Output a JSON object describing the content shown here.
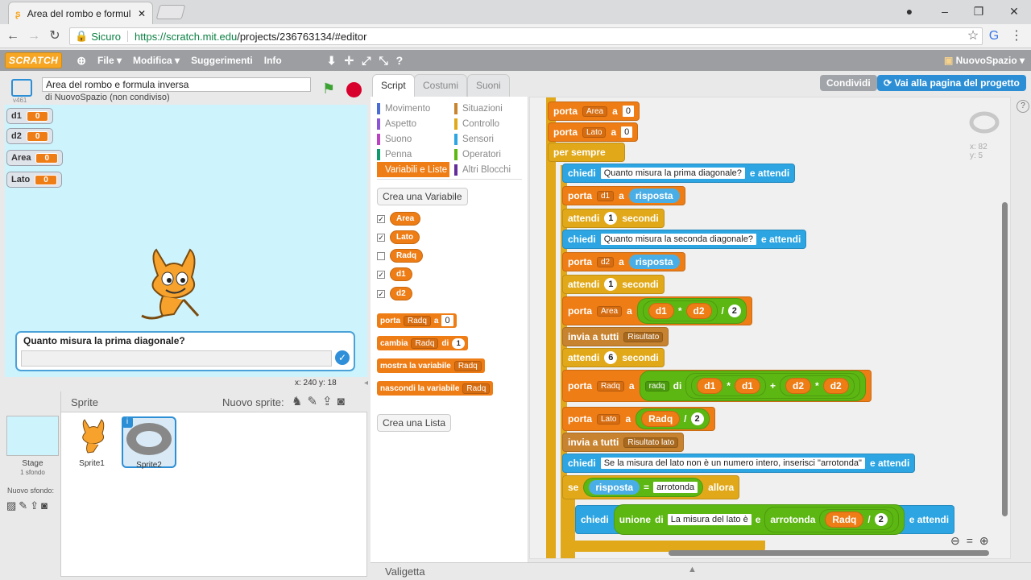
{
  "browser": {
    "tab_title": "Area del rombo e formul…",
    "secure_label": "Sicuro",
    "url_prefix": "https://scratch.mit.edu",
    "url_path": "/projects/236763134/#editor"
  },
  "menubar": {
    "logo": "SCRATCH",
    "items": [
      "File ▾",
      "Modifica ▾",
      "Suggerimenti",
      "Info"
    ],
    "user": "NuovoSpazio ▾"
  },
  "project": {
    "title": "Area del rombo e formula inversa",
    "byline": "di NuovoSpazio (non condiviso)",
    "version": "v461"
  },
  "monitors": [
    {
      "name": "d1",
      "value": "0"
    },
    {
      "name": "d2",
      "value": "0"
    },
    {
      "name": "Area",
      "value": "0"
    },
    {
      "name": "Lato",
      "value": "0"
    }
  ],
  "ask": {
    "question": "Quanto misura la prima diagonale?"
  },
  "stage_coords": "x: 240   y: 18",
  "sprites": {
    "header": "Sprite",
    "new_sprite": "Nuovo sprite:",
    "stage_label": "Stage",
    "stage_sub": "1 sfondo",
    "new_backdrop": "Nuovo sfondo:",
    "items": [
      "Sprite1",
      "Sprite2"
    ]
  },
  "tabs": [
    "Script",
    "Costumi",
    "Suoni"
  ],
  "buttons": {
    "share": "Condividi",
    "project_page": "Vai alla pagina del progetto"
  },
  "categories": [
    {
      "name": "Movimento",
      "color": "#4a6cd4"
    },
    {
      "name": "Situazioni",
      "color": "#c88330"
    },
    {
      "name": "Aspetto",
      "color": "#8a55d7"
    },
    {
      "name": "Controllo",
      "color": "#e1a91a"
    },
    {
      "name": "Suono",
      "color": "#bb42c3"
    },
    {
      "name": "Sensori",
      "color": "#2ca5e2"
    },
    {
      "name": "Penna",
      "color": "#0e9a6c"
    },
    {
      "name": "Operatori",
      "color": "#5cb712"
    },
    {
      "name": "Variabili e Liste",
      "color": "#ee7d16"
    },
    {
      "name": "Altri Blocchi",
      "color": "#632d99"
    }
  ],
  "palette": {
    "make_var": "Crea una Variabile",
    "vars": [
      {
        "name": "Area",
        "checked": true
      },
      {
        "name": "Lato",
        "checked": true
      },
      {
        "name": "Radq",
        "checked": false
      },
      {
        "name": "d1",
        "checked": true
      },
      {
        "name": "d2",
        "checked": true
      }
    ],
    "blocks": [
      {
        "a": "porta",
        "var": "Radq",
        "b": "a",
        "val": "0"
      },
      {
        "a": "cambia",
        "var": "Radq",
        "b": "di",
        "val": "1"
      },
      {
        "a": "mostra la variabile",
        "var": "Radq"
      },
      {
        "a": "nascondi la variabile",
        "var": "Radq"
      }
    ],
    "make_list": "Crea una Lista"
  },
  "sprite_info": {
    "x": "x: 82",
    "y": "y: 5"
  },
  "script": {
    "porta": "porta",
    "a": "a",
    "per_sempre": "per sempre",
    "chiedi": "chiedi",
    "e_attendi": "e attendi",
    "risposta": "risposta",
    "attendi": "attendi",
    "secondi": "secondi",
    "invia": "invia a tutti",
    "di": "di",
    "se": "se",
    "allora": "allora",
    "unione": "unione",
    "arrotonda": "arrotonda",
    "q1": "Quanto misura la prima diagonale?",
    "q2": "Quanto misura la seconda diagonale?",
    "q3": "Se la misura del lato non è un numero intero, inserisci \"arrotonda\"",
    "q4": "La misura del lato è",
    "msg1": "Risultato",
    "msg2": "Risultato lato",
    "arrotonda_txt": "arrotonda",
    "radq": "radq",
    "wait1": "1",
    "wait6": "6",
    "two": "2",
    "zero": "0",
    "v_area": "Area",
    "v_lato": "Lato",
    "v_d1": "d1",
    "v_d2": "d2",
    "v_radq": "Radq",
    "op_mul": "*",
    "op_div": "/",
    "op_add": "+",
    "op_eq": "="
  },
  "bottom": {
    "backpack": "Valigetta"
  }
}
